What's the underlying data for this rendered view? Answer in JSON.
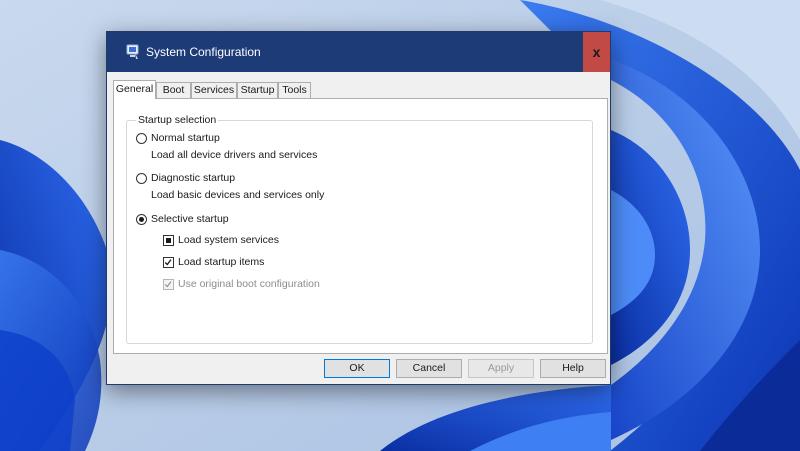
{
  "window": {
    "title": "System Configuration",
    "close_glyph": "x"
  },
  "tabs": [
    {
      "label": "General",
      "active": true
    },
    {
      "label": "Boot",
      "active": false
    },
    {
      "label": "Services",
      "active": false
    },
    {
      "label": "Startup",
      "active": false
    },
    {
      "label": "Tools",
      "active": false
    }
  ],
  "startup_selection": {
    "group_label": "Startup selection",
    "normal": {
      "label": "Normal startup",
      "description": "Load all device drivers and services",
      "selected": false
    },
    "diagnostic": {
      "label": "Diagnostic startup",
      "description": "Load basic devices and services only",
      "selected": false
    },
    "selective": {
      "label": "Selective startup",
      "selected": true
    },
    "options": {
      "load_system_services": {
        "label": "Load system services",
        "state": "indeterminate"
      },
      "load_startup_items": {
        "label": "Load startup items",
        "state": "checked"
      },
      "use_original_boot": {
        "label": "Use original boot configuration",
        "state": "checked-disabled"
      }
    }
  },
  "buttons": {
    "ok": "OK",
    "cancel": "Cancel",
    "apply": "Apply",
    "help": "Help"
  },
  "icons": {
    "app": "msconfig-icon",
    "close": "close-icon"
  },
  "colors": {
    "titlebar": "#1c3b77",
    "close_button": "#c24a45",
    "wallpaper_bloom": "#1f5ce0"
  }
}
